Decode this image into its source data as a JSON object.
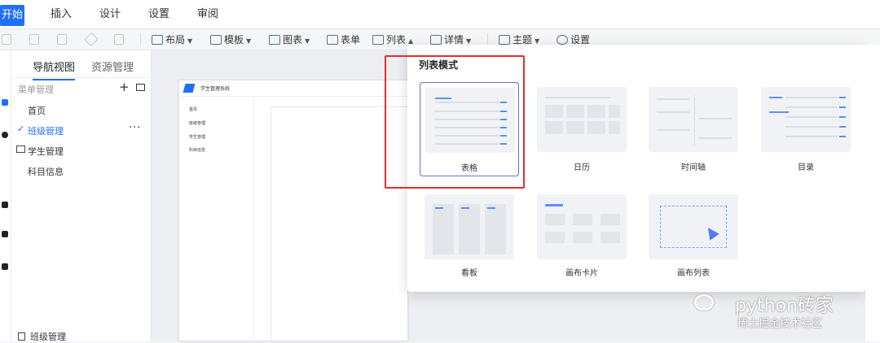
{
  "topmenu": {
    "start": "开始",
    "insert": "插入",
    "design": "设计",
    "settings": "设置",
    "review": "审阅"
  },
  "toolbar": {
    "layout": "布局",
    "template": "模板",
    "chart": "图表",
    "form": "表单",
    "list": "列表",
    "detail": "详情",
    "theme": "主题",
    "settings": "设置"
  },
  "nav": {
    "tab_nav": "导航视图",
    "tab_res": "资源管理",
    "menu_header": "菜单管理",
    "more": "···",
    "items": [
      "首页",
      "班级管理",
      "学生管理",
      "科目信息"
    ],
    "bottom": "班级管理"
  },
  "preview": {
    "title": "学生管理系统",
    "items": [
      "首页",
      "班级管理",
      "学生管理",
      "科目信息"
    ]
  },
  "popup": {
    "title": "列表模式",
    "cards": [
      "表格",
      "日历",
      "时间轴",
      "目录",
      "看板",
      "画布卡片",
      "画布列表"
    ]
  },
  "watermark": {
    "line1": "python砖家",
    "line2": "稀土掘金技术社区"
  }
}
